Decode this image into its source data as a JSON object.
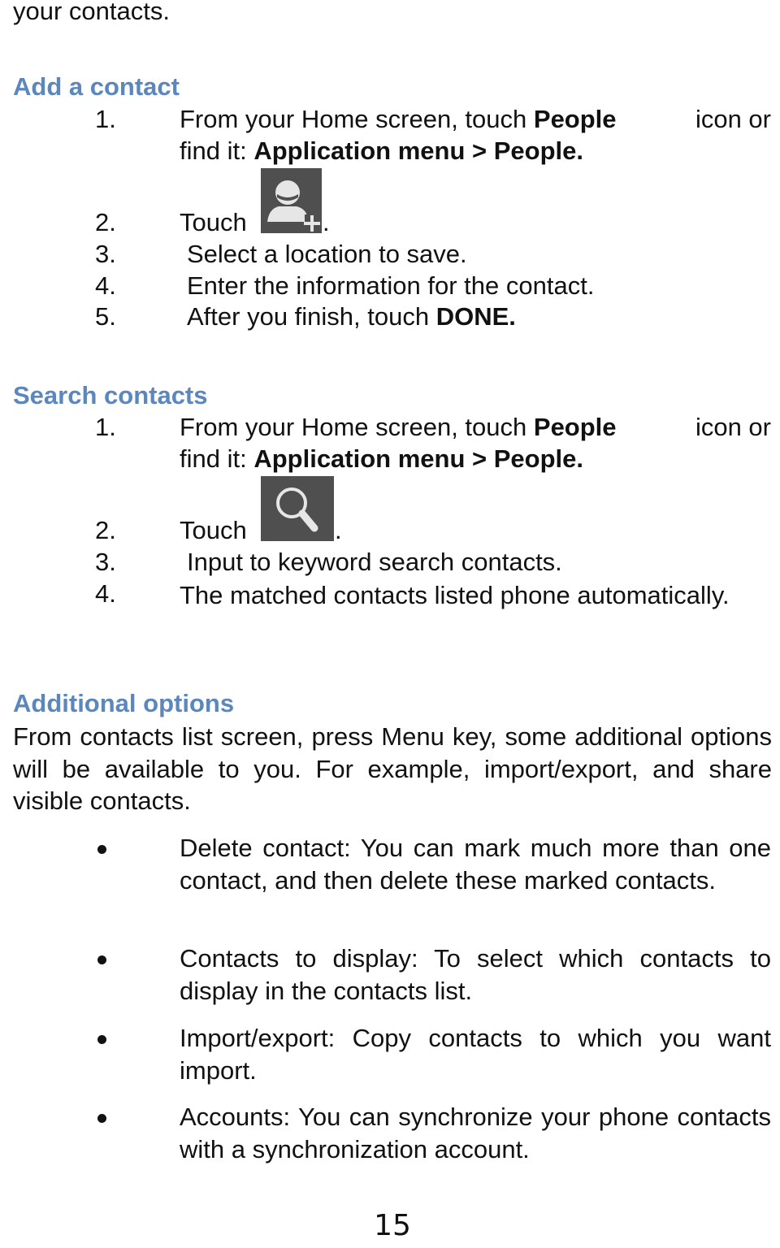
{
  "intro_tail": "your contacts.",
  "sections": {
    "add": {
      "heading": "Add a contact",
      "steps": [
        {
          "num": "1.",
          "line1_pre": "From your Home screen, touch ",
          "line1_bold": "People",
          "line1_post": " icon or",
          "line2_pre": "find it: ",
          "line2_bold": "Application menu > People."
        },
        {
          "num": "2.",
          "text": "Touch",
          "icon": "add-contact-icon",
          "suffix": "."
        },
        {
          "num": "3.",
          "text": "Select a location to save."
        },
        {
          "num": "4.",
          "text": "Enter the information for the contact."
        },
        {
          "num": "5.",
          "text_pre": "After you finish, touch ",
          "text_bold": "DONE."
        }
      ]
    },
    "search": {
      "heading": "Search contacts",
      "steps": [
        {
          "num": "1.",
          "line1_pre": "From your Home screen, touch ",
          "line1_bold": "People",
          "line1_post": " icon or",
          "line2_pre": "find it: ",
          "line2_bold": "Application menu > People."
        },
        {
          "num": "2.",
          "text": "Touch",
          "icon": "search-icon",
          "suffix": "."
        },
        {
          "num": "3.",
          "text": "Input to keyword search contacts."
        },
        {
          "num": "4.",
          "text": "The matched contacts listed phone automatically."
        }
      ]
    },
    "additional": {
      "heading": "Additional options",
      "paragraph": "From contacts list screen, press Menu key, some additional options will be available to you. For example, import/export, and share visible contacts.",
      "bullets": [
        "Delete contact: You can mark much more than one contact, and then delete these marked contacts.",
        "Contacts to display: To select which contacts to display in the contacts list.",
        "Import/export: Copy contacts to which you want import.",
        "Accounts: You can synchronize your phone contacts with a synchronization account."
      ]
    }
  },
  "page_number": "15",
  "colors": {
    "heading": "#5b87bd",
    "icon_bg": "#4f4f4f",
    "icon_fg": "#e6e6e6"
  }
}
